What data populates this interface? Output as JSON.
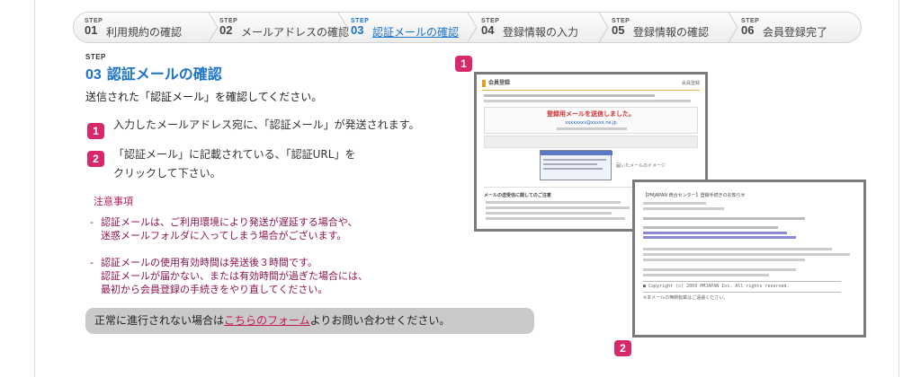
{
  "steps": [
    {
      "label": "STEP",
      "num": "01",
      "text": "利用規約の確認",
      "active": false
    },
    {
      "label": "STEP",
      "num": "02",
      "text": "メールアドレスの確認",
      "active": false
    },
    {
      "label": "STEP",
      "num": "03",
      "text": "認証メールの確認",
      "active": true
    },
    {
      "label": "STEP",
      "num": "04",
      "text": "登録情報の入力",
      "active": false
    },
    {
      "label": "STEP",
      "num": "05",
      "text": "登録情報の確認",
      "active": false
    },
    {
      "label": "STEP",
      "num": "06",
      "text": "会員登録完了",
      "active": false
    }
  ],
  "section": {
    "step_label": "STEP",
    "num": "03",
    "title": "認証メールの確認",
    "intro": "送信された「認証メール」を確認してください。"
  },
  "items": [
    {
      "badge": "1",
      "lines": [
        "入力したメールアドレス宛に、「認証メール」が発送されます。"
      ]
    },
    {
      "badge": "2",
      "lines": [
        "「認証メール」に記載されている、「認証URL」を",
        "クリックして下さい。"
      ]
    }
  ],
  "notice": {
    "heading": "注意事項",
    "blocks": [
      {
        "dash": "-",
        "lines": [
          "認証メールは、ご利用環境により発送が遅延する場合や、",
          "迷惑メールフォルダに入ってしまう場合がございます。"
        ]
      },
      {
        "dash": "-",
        "lines": [
          "認証メールの使用有効時間は発送後３時間です。",
          "認証メールが届かない、または有効時間が過ぎた場合には、",
          "最初から会員登録の手続きをやり直してください。"
        ]
      }
    ]
  },
  "contact": {
    "prefix": "正常に進行されない場合は",
    "link": "こちらのフォーム",
    "suffix": "よりお問い合わせください。"
  },
  "screenshot_badges": [
    "1",
    "2"
  ],
  "shot1": {
    "header": "会員登録",
    "header_right": "会員登録",
    "sent_title": "登録用メールを送信しました。",
    "sent_email": "xxxxxxxx@xxxxx.ne.jp",
    "mail_caption": "届いたメールのイメージ",
    "help_title": "メールの送受信に関してのご注意"
  },
  "shot2": {
    "subject": "【PMJAPAN 統合センター】登録手続きのお知らせ",
    "copyright": "■ Copyright (c) 2009 PMJAPAN Inc. All rights reserved.",
    "footer": "※本メールの無断転載はご遠慮ください。"
  },
  "colors": {
    "accent": "#1a73c8",
    "badge": "#d6286b",
    "notice": "#8c1450",
    "link": "#c2185b"
  }
}
